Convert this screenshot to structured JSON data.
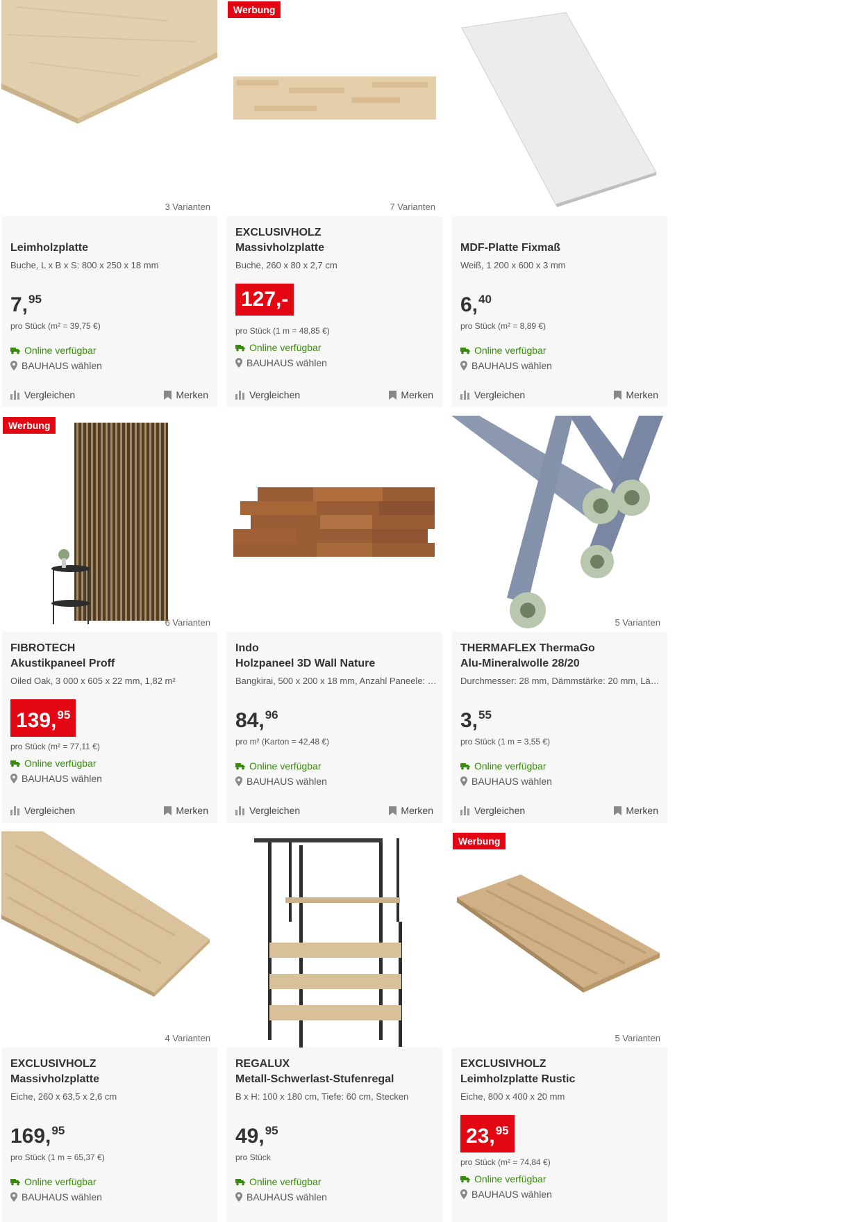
{
  "labels": {
    "online": "Online verfügbar",
    "store": "BAUHAUS wählen",
    "compare": "Vergleichen",
    "remember": "Merken"
  },
  "colors": {
    "accent": "#e30613",
    "available": "#3a8a0e"
  },
  "products": [
    {
      "badge": "",
      "variants": "3 Varianten",
      "brand": "",
      "title": "Leimholzplatte",
      "desc": "Buche, L x B x S: 800 x 250 x 18 mm",
      "price_main": "7,",
      "price_cents": "95",
      "price_red": false,
      "unit": "pro Stück (m² = 39,75 €)",
      "image": "beech-board-icon"
    },
    {
      "badge": "Werbung",
      "variants": "7 Varianten",
      "brand": "EXCLUSIVHOLZ",
      "title": "Massivholzplatte",
      "desc": "Buche, 260 x 80 x 2,7 cm",
      "price_main": "127,-",
      "price_cents": "",
      "price_red": true,
      "unit": "pro Stück (1 m = 48,85 €)",
      "image": "wood-panel-icon"
    },
    {
      "badge": "",
      "variants": "",
      "brand": "",
      "title": "MDF-Platte Fixmaß",
      "desc": "Weiß, 1 200 x 600 x 3 mm",
      "price_main": "6,",
      "price_cents": "40",
      "price_red": false,
      "unit": "pro Stück (m² = 8,89 €)",
      "image": "mdf-board-icon"
    },
    {
      "badge": "Werbung",
      "variants": "6 Varianten",
      "brand": "FIBROTECH",
      "title": "Akustikpaneel Proff",
      "desc": "Oiled Oak, 3 000 x 605 x 22 mm, 1,82 m²",
      "price_main": "139,",
      "price_cents": "95",
      "price_red": true,
      "unit": "pro Stück (m² = 77,11 €)",
      "image": "acoustic-panel-icon"
    },
    {
      "badge": "",
      "variants": "",
      "brand": "Indo",
      "title": "Holzpaneel 3D Wall Nature",
      "desc": "Bangkirai, 500 x 200 x 18 mm, Anzahl Paneele: …",
      "price_main": "84,",
      "price_cents": "96",
      "price_red": false,
      "unit": "pro m² (Karton = 42,48 €)",
      "image": "wall-panel-icon"
    },
    {
      "badge": "",
      "variants": "5 Varianten",
      "brand": "THERMAFLEX ThermaGo",
      "title": "Alu-Mineralwolle 28/20",
      "desc": "Durchmesser: 28 mm, Dämmstärke: 20 mm, Lä…",
      "price_main": "3,",
      "price_cents": "55",
      "price_red": false,
      "unit": "pro Stück (1 m = 3,55 €)",
      "image": "pipe-insulation-icon"
    },
    {
      "badge": "",
      "variants": "4 Varianten",
      "brand": "EXCLUSIVHOLZ",
      "title": "Massivholzplatte",
      "desc": "Eiche, 260 x 63,5 x 2,6 cm",
      "price_main": "169,",
      "price_cents": "95",
      "price_red": false,
      "unit": "pro Stück (1 m = 65,37 €)",
      "image": "oak-board-icon"
    },
    {
      "badge": "",
      "variants": "",
      "brand": "REGALUX",
      "title": "Metall-Schwerlast-Stufenregal",
      "desc": "B x H: 100 x 180 cm, Tiefe: 60 cm, Stecken",
      "price_main": "49,",
      "price_cents": "95",
      "price_red": false,
      "unit": "pro Stück",
      "image": "shelf-icon"
    },
    {
      "badge": "Werbung",
      "variants": "5 Varianten",
      "brand": "EXCLUSIVHOLZ",
      "title": "Leimholzplatte Rustic",
      "desc": "Eiche, 800 x 400 x 20 mm",
      "price_main": "23,",
      "price_cents": "95",
      "price_red": true,
      "unit": "pro Stück (m² = 74,84 €)",
      "image": "rustic-board-icon"
    }
  ]
}
